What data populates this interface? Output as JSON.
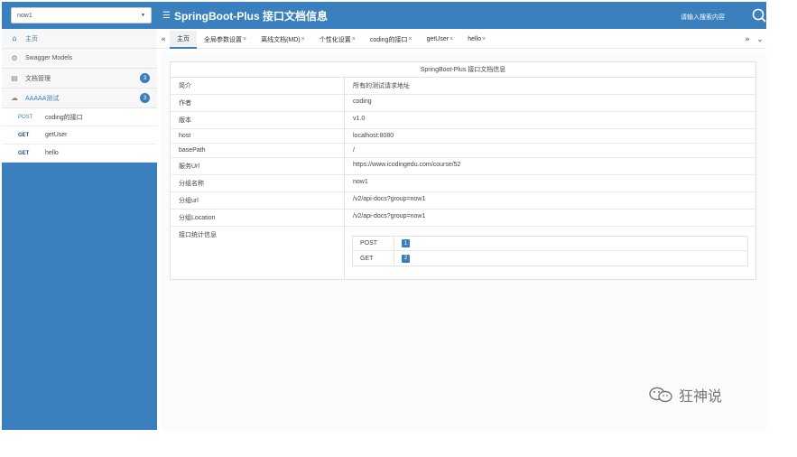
{
  "header": {
    "group_select_value": "now1",
    "title": "SpringBoot-Plus 接口文档信息",
    "search_placeholder": "请输入搜索内容"
  },
  "sidebar": {
    "home": "主页",
    "swagger_models": "Swagger Models",
    "doc_manage": "文档管理",
    "doc_manage_count": "3",
    "test_group": "AAAAA测试",
    "test_group_count": "3",
    "apis": [
      {
        "method": "POST",
        "name": "coding的接口"
      },
      {
        "method": "GET",
        "name": "getUser"
      },
      {
        "method": "GET",
        "name": "hello"
      }
    ]
  },
  "tabs": [
    {
      "label": "主页",
      "closable": false
    },
    {
      "label": "全局参数设置",
      "closable": true
    },
    {
      "label": "离线文档(MD)",
      "closable": true
    },
    {
      "label": "个性化设置",
      "closable": true
    },
    {
      "label": "coding的接口",
      "closable": true
    },
    {
      "label": "getUser",
      "closable": true
    },
    {
      "label": "hello",
      "closable": true
    }
  ],
  "tab_close_glyph": "×",
  "info": {
    "caption": "SpringBoot-Plus 接口文档信息",
    "rows": [
      {
        "key": "简介",
        "value": "所有的测试请求地址"
      },
      {
        "key": "作者",
        "value": "coding"
      },
      {
        "key": "版本",
        "value": "v1.0"
      },
      {
        "key": "host",
        "value": "localhost:8080"
      },
      {
        "key": "basePath",
        "value": "/"
      },
      {
        "key": "服务Url",
        "value": "https://www.icodingedu.com/course/52"
      },
      {
        "key": "分组名称",
        "value": "now1"
      },
      {
        "key": "分组url",
        "value": "/v2/api-docs?group=now1"
      },
      {
        "key": "分组Location",
        "value": "/v2/api-docs?group=now1"
      }
    ],
    "stats_key": "接口统计信息",
    "stats": [
      {
        "method": "POST",
        "count": "1"
      },
      {
        "method": "GET",
        "count": "2"
      }
    ]
  },
  "watermark": "狂神说",
  "colors": {
    "brand": "#3a7fbe"
  }
}
